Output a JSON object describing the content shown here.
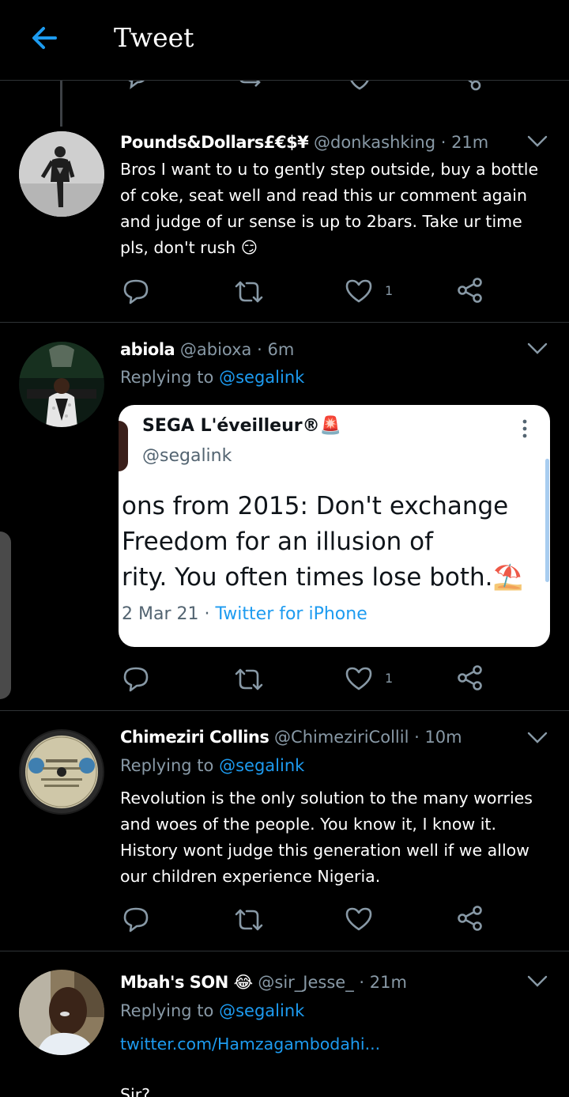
{
  "header": {
    "title": "Tweet",
    "back_icon": "back-arrow-icon",
    "accent": "#1d9bf0"
  },
  "tweets": [
    {
      "name": "Pounds&Dollars£€$¥",
      "handle": "@donkashking",
      "time": "· 21m",
      "text": "Bros I want to u to gently step outside, buy a bottle of coke, seat well and read this ur comment again and judge of ur sense is up to 2bars. Take ur time pls, don't rush 😏",
      "like_count": "1"
    },
    {
      "name": "abiola",
      "handle": "@abioxa",
      "time": "· 6m",
      "replying_prefix": "Replying to",
      "replying_handle": "@segalink",
      "like_count": "1",
      "quote": {
        "name": "SEGA L'éveilleur®🚨",
        "handle": "@segalink",
        "lines": [
          "ons from 2015: Don't exchange",
          " Freedom for an illusion of",
          "rity. You often times lose both.⛱️"
        ],
        "date": "2 Mar 21",
        "dot": "·",
        "source": "Twitter for iPhone"
      }
    },
    {
      "name": "Chimeziri Collins",
      "handle": "@ChimeziriCollil",
      "time": "· 10m",
      "replying_prefix": "Replying to",
      "replying_handle": "@segalink",
      "text": "Revolution is the only solution to the many worries and woes of the people. You know it, I know it. History wont judge this generation well if we allow our children experience Nigeria."
    },
    {
      "name": "Mbah's SON 😂",
      "handle": "@sir_Jesse_",
      "time": "· 21m",
      "replying_prefix": "Replying to",
      "replying_handle": "@segalink",
      "link": "twitter.com/Hamzagambodahi...",
      "text": "Sir?"
    }
  ]
}
